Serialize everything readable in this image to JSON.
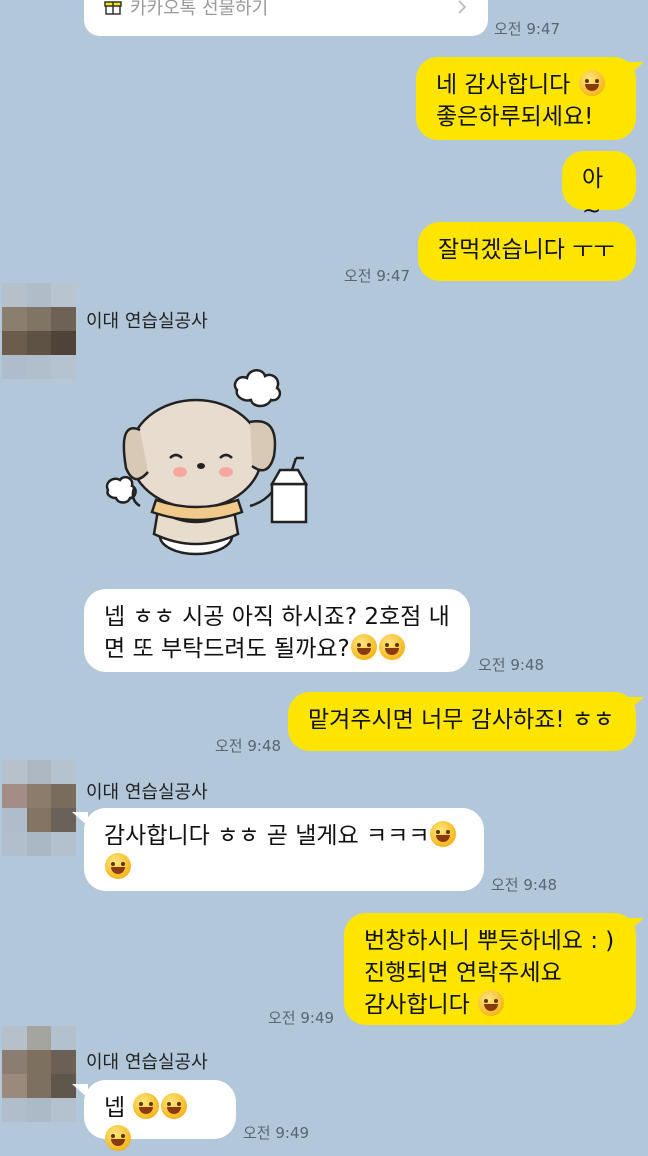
{
  "gift": {
    "label": "카카오톡 선물하기"
  },
  "messages": {
    "t1": "오전 9:47",
    "out1": {
      "line1": "네 감사합니다",
      "line2": "좋은하루되세요!"
    },
    "out2": "아~",
    "out3": "잘먹겠습니다 ㅜㅜ",
    "t2": "오전 9:47",
    "sender": "이대 연습실공사",
    "in1": {
      "line1": "넵 ㅎㅎ 시공 아직 하시죠? 2호점 내",
      "line2": "면 또 부탁드려도 될까요?"
    },
    "t3": "오전 9:48",
    "out4": "맡겨주시면 너무 감사하죠! ㅎㅎ",
    "t4": "오전 9:48",
    "sender2": "이대 연습실공사",
    "in2": {
      "line1": "감사합니다 ㅎㅎ 곧 낼게요 ㅋㅋㅋ"
    },
    "t5": "오전 9:48",
    "out5": {
      "line1": "번창하시니 뿌듯하네요 : )",
      "line2": "진행되면 연락주세요",
      "line3": "감사합니다"
    },
    "t6": "오전 9:49",
    "sender3": "이대 연습실공사",
    "in3": "넵",
    "t7": "오전 9:49"
  },
  "icons": [
    "gift-icon",
    "chevron-right-icon",
    "smile-emoji",
    "dog-sticker"
  ],
  "colors": {
    "background": "#b2c7da",
    "outgoing": "#fee500",
    "incoming": "#ffffff"
  }
}
